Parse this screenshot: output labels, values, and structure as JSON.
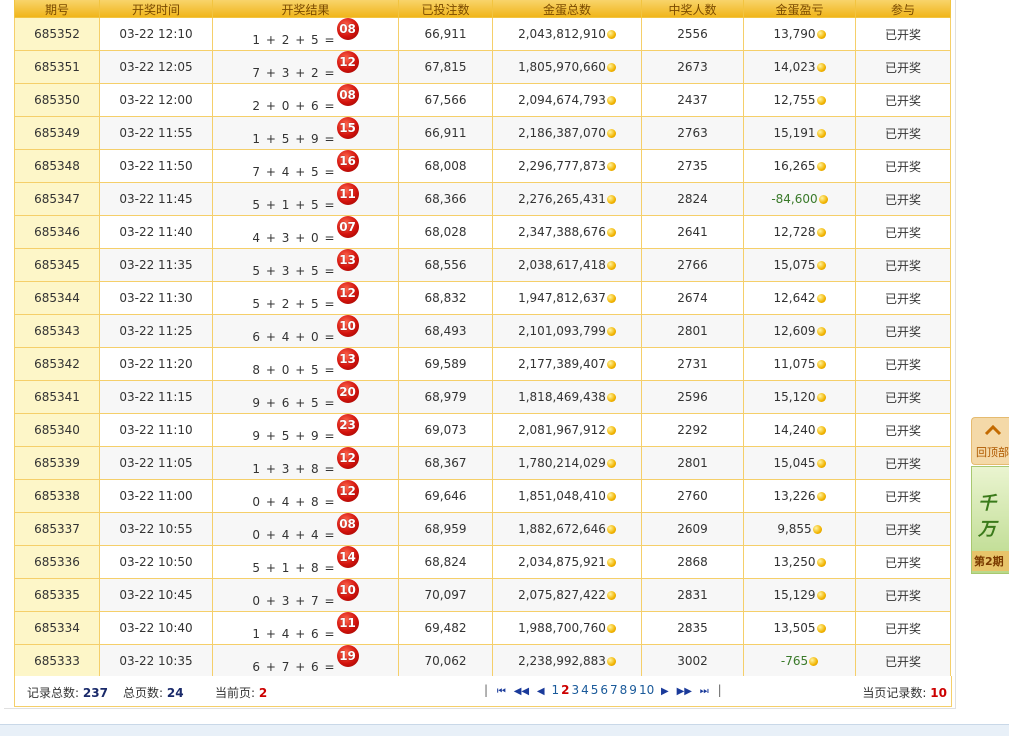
{
  "table": {
    "headers": [
      "期号",
      "开奖时间",
      "开奖结果",
      "已投注数",
      "金蛋总数",
      "中奖人数",
      "金蛋盈亏",
      "参与"
    ],
    "rows": [
      {
        "issue": "685352",
        "time": "03-22 12:10",
        "formula": "1 + 2 + 5 =",
        "result": "08",
        "bets": "66,911",
        "total": "2,043,812,910",
        "winners": "2556",
        "profit": "13,790",
        "status": "已开奖"
      },
      {
        "issue": "685351",
        "time": "03-22 12:05",
        "formula": "7 + 3 + 2 =",
        "result": "12",
        "bets": "67,815",
        "total": "1,805,970,660",
        "winners": "2673",
        "profit": "14,023",
        "status": "已开奖"
      },
      {
        "issue": "685350",
        "time": "03-22 12:00",
        "formula": "2 + 0 + 6 =",
        "result": "08",
        "bets": "67,566",
        "total": "2,094,674,793",
        "winners": "2437",
        "profit": "12,755",
        "status": "已开奖"
      },
      {
        "issue": "685349",
        "time": "03-22 11:55",
        "formula": "1 + 5 + 9 =",
        "result": "15",
        "bets": "66,911",
        "total": "2,186,387,070",
        "winners": "2763",
        "profit": "15,191",
        "status": "已开奖"
      },
      {
        "issue": "685348",
        "time": "03-22 11:50",
        "formula": "7 + 4 + 5 =",
        "result": "16",
        "bets": "68,008",
        "total": "2,296,777,873",
        "winners": "2735",
        "profit": "16,265",
        "status": "已开奖"
      },
      {
        "issue": "685347",
        "time": "03-22 11:45",
        "formula": "5 + 1 + 5 =",
        "result": "11",
        "bets": "68,366",
        "total": "2,276,265,431",
        "winners": "2824",
        "profit": "-84,600",
        "status": "已开奖"
      },
      {
        "issue": "685346",
        "time": "03-22 11:40",
        "formula": "4 + 3 + 0 =",
        "result": "07",
        "bets": "68,028",
        "total": "2,347,388,676",
        "winners": "2641",
        "profit": "12,728",
        "status": "已开奖"
      },
      {
        "issue": "685345",
        "time": "03-22 11:35",
        "formula": "5 + 3 + 5 =",
        "result": "13",
        "bets": "68,556",
        "total": "2,038,617,418",
        "winners": "2766",
        "profit": "15,075",
        "status": "已开奖"
      },
      {
        "issue": "685344",
        "time": "03-22 11:30",
        "formula": "5 + 2 + 5 =",
        "result": "12",
        "bets": "68,832",
        "total": "1,947,812,637",
        "winners": "2674",
        "profit": "12,642",
        "status": "已开奖"
      },
      {
        "issue": "685343",
        "time": "03-22 11:25",
        "formula": "6 + 4 + 0 =",
        "result": "10",
        "bets": "68,493",
        "total": "2,101,093,799",
        "winners": "2801",
        "profit": "12,609",
        "status": "已开奖"
      },
      {
        "issue": "685342",
        "time": "03-22 11:20",
        "formula": "8 + 0 + 5 =",
        "result": "13",
        "bets": "69,589",
        "total": "2,177,389,407",
        "winners": "2731",
        "profit": "11,075",
        "status": "已开奖"
      },
      {
        "issue": "685341",
        "time": "03-22 11:15",
        "formula": "9 + 6 + 5 =",
        "result": "20",
        "bets": "68,979",
        "total": "1,818,469,438",
        "winners": "2596",
        "profit": "15,120",
        "status": "已开奖"
      },
      {
        "issue": "685340",
        "time": "03-22 11:10",
        "formula": "9 + 5 + 9 =",
        "result": "23",
        "bets": "69,073",
        "total": "2,081,967,912",
        "winners": "2292",
        "profit": "14,240",
        "status": "已开奖"
      },
      {
        "issue": "685339",
        "time": "03-22 11:05",
        "formula": "1 + 3 + 8 =",
        "result": "12",
        "bets": "68,367",
        "total": "1,780,214,029",
        "winners": "2801",
        "profit": "15,045",
        "status": "已开奖"
      },
      {
        "issue": "685338",
        "time": "03-22 11:00",
        "formula": "0 + 4 + 8 =",
        "result": "12",
        "bets": "69,646",
        "total": "1,851,048,410",
        "winners": "2760",
        "profit": "13,226",
        "status": "已开奖"
      },
      {
        "issue": "685337",
        "time": "03-22 10:55",
        "formula": "0 + 4 + 4 =",
        "result": "08",
        "bets": "68,959",
        "total": "1,882,672,646",
        "winners": "2609",
        "profit": "9,855",
        "status": "已开奖"
      },
      {
        "issue": "685336",
        "time": "03-22 10:50",
        "formula": "5 + 1 + 8 =",
        "result": "14",
        "bets": "68,824",
        "total": "2,034,875,921",
        "winners": "2868",
        "profit": "13,250",
        "status": "已开奖"
      },
      {
        "issue": "685335",
        "time": "03-22 10:45",
        "formula": "0 + 3 + 7 =",
        "result": "10",
        "bets": "70,097",
        "total": "2,075,827,422",
        "winners": "2831",
        "profit": "15,129",
        "status": "已开奖"
      },
      {
        "issue": "685334",
        "time": "03-22 10:40",
        "formula": "1 + 4 + 6 =",
        "result": "11",
        "bets": "69,482",
        "total": "1,988,700,760",
        "winners": "2835",
        "profit": "13,505",
        "status": "已开奖"
      },
      {
        "issue": "685333",
        "time": "03-22 10:35",
        "formula": "6 + 7 + 6 =",
        "result": "19",
        "bets": "70,062",
        "total": "2,238,992,883",
        "winners": "3002",
        "profit": "-765",
        "status": "已开奖"
      }
    ]
  },
  "footer": {
    "total_records_label": "记录总数:",
    "total_records": "237",
    "total_pages_label": "总页数:",
    "total_pages": "24",
    "current_page_label": "当前页:",
    "current_page": "2",
    "page_records_label": "当页记录数:",
    "page_records": "10"
  },
  "pager": {
    "first_icon": "⏮",
    "prev_icon": "◀◀",
    "prev_one_icon": "◀",
    "pages": [
      "1",
      "2",
      "3",
      "4",
      "5",
      "6",
      "7",
      "8",
      "9",
      "10"
    ],
    "current": "2",
    "next_one_icon": "▶",
    "next_icon": "▶▶",
    "last_icon": "⏭",
    "separator": "|"
  },
  "side": {
    "back_top_label": "回顶部",
    "back_top_icon": "chevron-up-icon",
    "ad_text": "千万",
    "ad_sub": "第2期"
  },
  "colors": {
    "header_gold": "#f0b418",
    "win_red": "#e0141e",
    "loss_green": "#3a7a2a",
    "ball_red": "#d3120c"
  }
}
